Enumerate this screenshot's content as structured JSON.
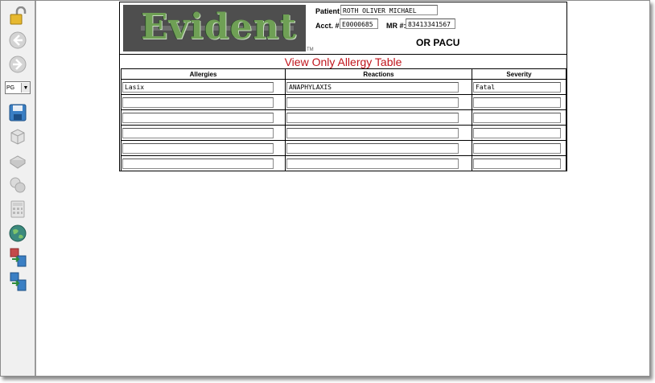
{
  "toolbar": {
    "icons": [
      "unlock-icon",
      "back-icon",
      "forward-icon",
      "save-icon",
      "copy-icon",
      "print-icon",
      "merge-icon",
      "calculator-icon",
      "globe-icon",
      "export-icon",
      "import-icon"
    ],
    "page_select": "PG"
  },
  "header": {
    "logo_text": "Evident",
    "trademark": "TM",
    "patient_label": "Patient:",
    "patient_value": "ROTH OLIVER MICHAEL",
    "acct_label": "Acct. #:",
    "acct_value": "E0000685",
    "mr_label": "MR #:",
    "mr_value": "83413341567",
    "unit": "OR PACU"
  },
  "table": {
    "title": "View Only Allergy Table",
    "columns": [
      "Allergies",
      "Reactions",
      "Severity"
    ],
    "rows": [
      [
        "Lasix",
        "ANAPHYLAXIS",
        "Fatal"
      ],
      [
        "",
        "",
        ""
      ],
      [
        "",
        "",
        ""
      ],
      [
        "",
        "",
        ""
      ],
      [
        "",
        "",
        ""
      ],
      [
        "",
        "",
        ""
      ]
    ]
  },
  "colors": {
    "title_red": "#c0141c",
    "logo_bg": "#4e4e4e",
    "logo_green": "#6fa055"
  }
}
